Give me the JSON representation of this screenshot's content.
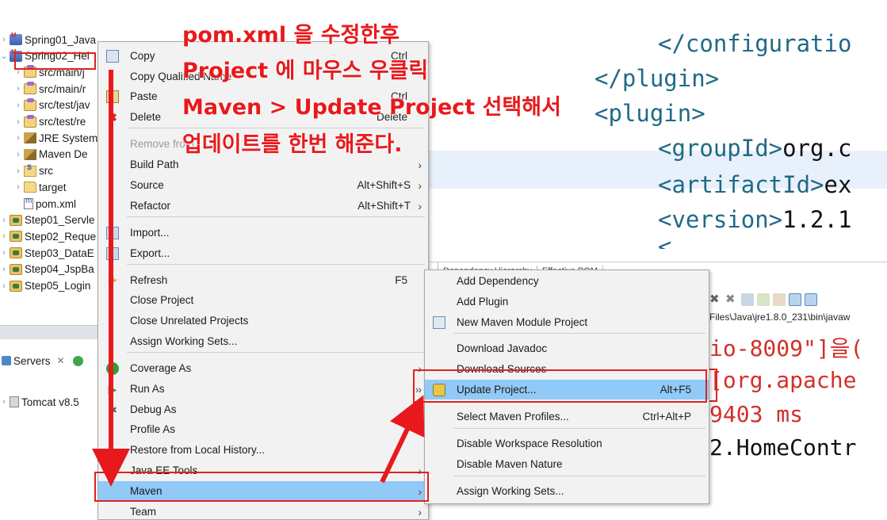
{
  "annotation": {
    "line1": "pom.xml   을 수정한후",
    "line2": "Project 에 마우스 우클릭",
    "line3": "Maven > Update Project 선택해서",
    "line4": "업데이트를 한번 해준다."
  },
  "explorer": {
    "items": [
      {
        "label": "Spring01_Java",
        "icon": "maven-project-icon"
      },
      {
        "label": "Spring02_Hel",
        "icon": "maven-project-icon",
        "selected": true
      },
      {
        "label": "src/main/j",
        "icon": "package-folder-icon"
      },
      {
        "label": "src/main/r",
        "icon": "package-folder-icon"
      },
      {
        "label": "src/test/jav",
        "icon": "package-folder-icon"
      },
      {
        "label": "src/test/re",
        "icon": "package-folder-icon"
      },
      {
        "label": "JRE System",
        "icon": "library-icon"
      },
      {
        "label": "Maven De",
        "icon": "library-icon"
      },
      {
        "label": "src",
        "icon": "source-folder-icon"
      },
      {
        "label": "target",
        "icon": "folder-icon"
      },
      {
        "label": "pom.xml",
        "icon": "pom-file-icon"
      },
      {
        "label": "Step01_Servle",
        "icon": "web-project-icon"
      },
      {
        "label": "Step02_Reque",
        "icon": "web-project-icon"
      },
      {
        "label": "Step03_DataE",
        "icon": "web-project-icon"
      },
      {
        "label": "Step04_JspBa",
        "icon": "web-project-icon"
      },
      {
        "label": "Step05_Login",
        "icon": "web-project-icon"
      }
    ]
  },
  "servers": {
    "tab_label": "Servers",
    "tomcat_label": "Tomcat v8.5"
  },
  "editor": {
    "lines": [
      {
        "tag": "</configuratio",
        "text": ""
      },
      {
        "tag": "</plugin>",
        "text": ""
      },
      {
        "tag": "<plugin>",
        "text": ""
      },
      {
        "tag": "<groupId>",
        "text": "org.c"
      },
      {
        "tag": "<artifactId>",
        "text": "ex"
      },
      {
        "tag": "<version>",
        "text": "1.2.1"
      }
    ],
    "tabs": [
      "",
      "Dependency Hierarchy",
      "Effective POM"
    ]
  },
  "console": {
    "path": "Files\\Java\\jre1.8.0_231\\bin\\javaw",
    "lines": [
      {
        "text": "io-8009\"]을(",
        "color": "red"
      },
      {
        "text": "[org.apache",
        "color": "red"
      },
      {
        "text": "9403 ms",
        "color": "red"
      },
      {
        "text": "2.HomeContr",
        "color": "black"
      }
    ]
  },
  "context_menu": {
    "items": [
      {
        "label": "Copy",
        "key": "Ctrl",
        "icon": "copy-icon"
      },
      {
        "label": "Copy Qualified Name",
        "key": "",
        "icon": ""
      },
      {
        "label": "Paste",
        "key": "Ctrl",
        "icon": "paste-icon"
      },
      {
        "label": "Delete",
        "key": "Delete",
        "icon": "delete-icon"
      },
      {
        "label": "Remove from",
        "key": "",
        "icon": "",
        "disabled": true
      },
      {
        "label": "Build Path",
        "key": "",
        "arrow": true
      },
      {
        "label": "Source",
        "key": "Alt+Shift+S",
        "arrow": true
      },
      {
        "label": "Refactor",
        "key": "Alt+Shift+T",
        "arrow": true
      },
      {
        "label": "Import...",
        "key": "",
        "icon": "import-icon"
      },
      {
        "label": "Export...",
        "key": "",
        "icon": "export-icon"
      },
      {
        "label": "Refresh",
        "key": "F5",
        "icon": "refresh-icon"
      },
      {
        "label": "Close Project",
        "key": ""
      },
      {
        "label": "Close Unrelated Projects",
        "key": ""
      },
      {
        "label": "Assign Working Sets...",
        "key": ""
      },
      {
        "label": "Coverage As",
        "key": "",
        "arrow": true,
        "icon": "coverage-icon"
      },
      {
        "label": "Run As",
        "key": "",
        "arrow": true,
        "icon": "run-icon"
      },
      {
        "label": "Debug As",
        "key": "",
        "arrow": true,
        "icon": "debug-icon"
      },
      {
        "label": "Profile As",
        "key": "",
        "arrow": true
      },
      {
        "label": "Restore from Local History...",
        "key": ""
      },
      {
        "label": "Java EE Tools",
        "key": "",
        "arrow": true
      },
      {
        "label": "Maven",
        "key": "",
        "arrow": true,
        "active": true
      },
      {
        "label": "Team",
        "key": "",
        "arrow": true
      }
    ]
  },
  "maven_submenu": {
    "items": [
      {
        "label": "Add Dependency",
        "key": ""
      },
      {
        "label": "Add Plugin",
        "key": ""
      },
      {
        "label": "New Maven Module Project",
        "key": "",
        "icon": "maven-module-icon"
      },
      {
        "label": "Download Javadoc",
        "key": ""
      },
      {
        "label": "Download Sources",
        "key": ""
      },
      {
        "label": "Update Project...",
        "key": "Alt+F5",
        "icon": "update-project-icon",
        "active": true
      },
      {
        "label": "Select Maven Profiles...",
        "key": "Ctrl+Alt+P"
      },
      {
        "label": "Disable Workspace Resolution",
        "key": ""
      },
      {
        "label": "Disable Maven Nature",
        "key": ""
      },
      {
        "label": "Assign Working Sets...",
        "key": ""
      }
    ]
  },
  "colors": {
    "annotation_red": "#e8191c",
    "menu_highlight": "#91c9f7",
    "code_tag": "#1f6a86",
    "console_red": "#d3302a"
  }
}
